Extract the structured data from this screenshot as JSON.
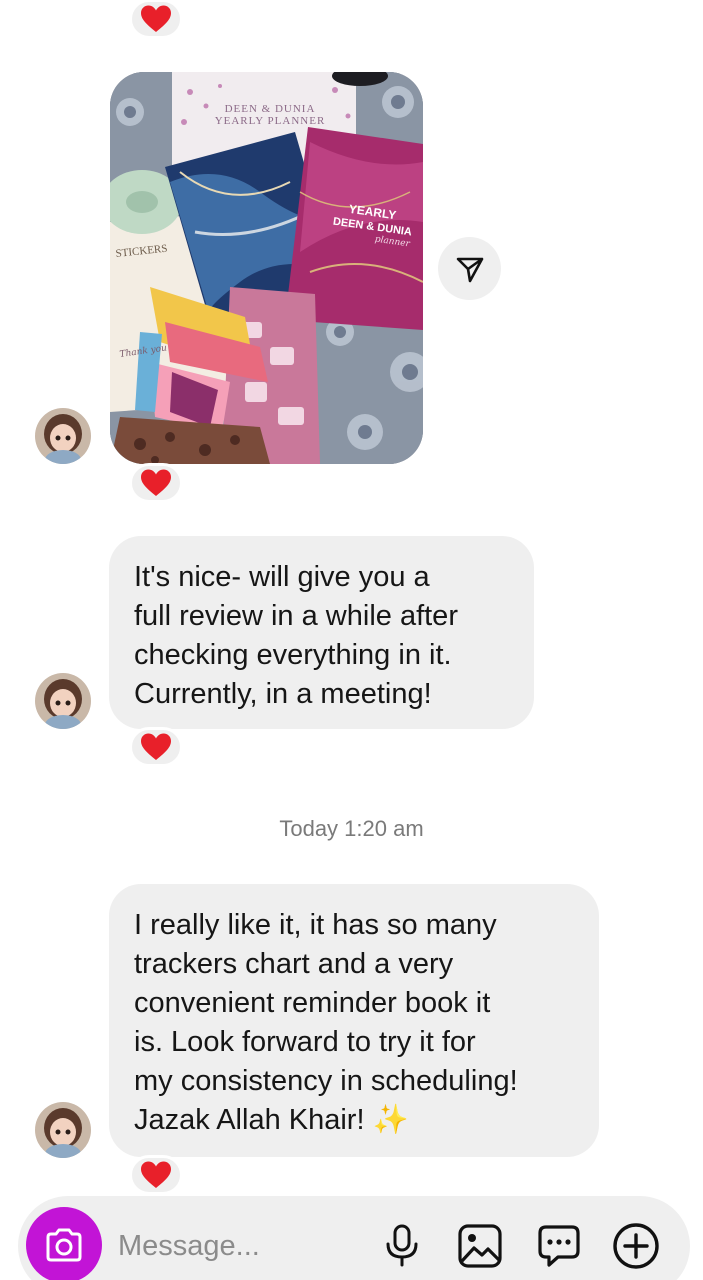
{
  "conversation": {
    "photo_message": {
      "alt": "Photo of yearly planners, stickers and bookmarks",
      "reaction": "heart"
    },
    "messages": [
      {
        "text": "It's nice- will give you a\nfull review in a while after\nchecking everything in it.\nCurrently, in a meeting!",
        "reaction": "heart"
      },
      {
        "text": "I really like it, it has so many\ntrackers chart and a very\nconvenient reminder book it\nis. Look forward to try it for\nmy consistency in scheduling!\nJazak Allah Khair! ✨",
        "reaction": "heart"
      }
    ],
    "timestamp": "Today 1:20 am"
  },
  "photo_texts": {
    "planner_back": "DEEN & DUNIA\nYEARLY PLANNER",
    "planner_front_line1": "YEARLY",
    "planner_front_line2": "DEEN & DUNIA",
    "planner_front_script": "planner",
    "stickers_label": "STICKERS",
    "thank_you": "Thank you"
  },
  "composer": {
    "placeholder": "Message...",
    "icons": [
      "camera-icon",
      "microphone-icon",
      "gallery-icon",
      "sticker-chat-icon",
      "plus-circle-icon"
    ]
  },
  "colors": {
    "bubble": "#efefef",
    "camera_button": "#c214d6",
    "heart": "#e8202a",
    "timestamp": "#7a7a7a"
  }
}
